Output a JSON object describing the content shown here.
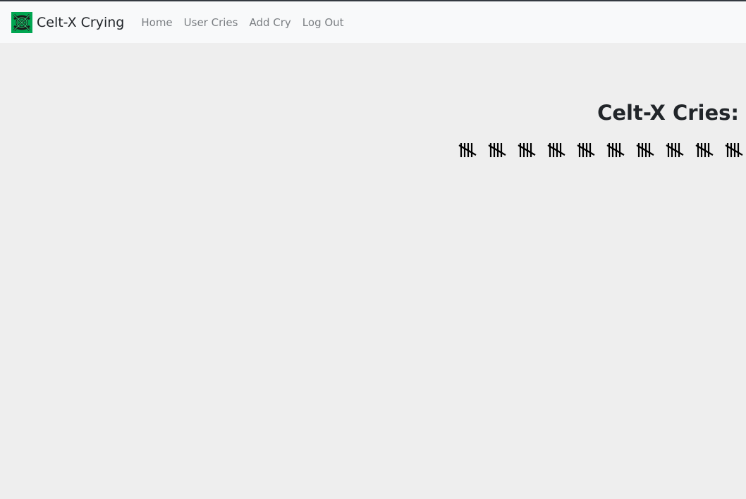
{
  "navbar": {
    "brand": "Celt-X Crying",
    "logo_icon": "celtic-knot-icon",
    "logo_colors": {
      "background": "#00a651",
      "knot": "#1a1a1a"
    },
    "links": [
      {
        "label": "Home"
      },
      {
        "label": "User Cries"
      },
      {
        "label": "Add Cry"
      },
      {
        "label": "Log Out"
      }
    ]
  },
  "main": {
    "title": "Celt-X Cries:",
    "tally": {
      "icon": "tally-marks-icon",
      "groups_visible": 10,
      "marks_per_group": 5
    }
  },
  "colors": {
    "page_background": "#eeeeee",
    "navbar_background": "#f8f9fa",
    "nav_link": "#7b7f83",
    "text": "#212529"
  }
}
